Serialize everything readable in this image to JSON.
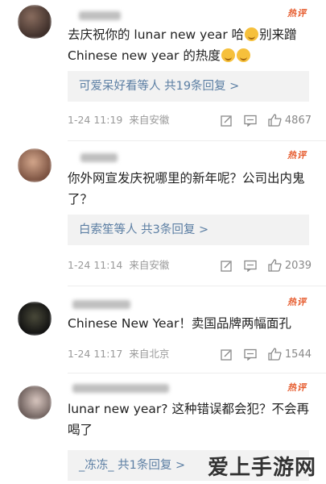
{
  "comments": [
    {
      "hot_label": "热评",
      "text_parts": [
        "去庆祝你的 lunar new year 哈",
        "别来蹭 Chinese new year 的热度"
      ],
      "replies": "可爱呆好看等人  共19条回复 >",
      "time": "1-24 11:19",
      "source": "来自安徽",
      "likes": "4867"
    },
    {
      "hot_label": "热评",
      "text": "你外网宣发庆祝哪里的新年呢？公司出内鬼了？",
      "replies": "白索笙等人  共3条回复 >",
      "time": "1-24 11:14",
      "source": "来自安徽",
      "likes": "2039"
    },
    {
      "hot_label": "热评",
      "text": "Chinese New Year！卖国品牌两幅面孔",
      "time": "1-24 11:17",
      "source": "来自北京",
      "likes": "1544"
    },
    {
      "hot_label": "热评",
      "text": "lunar new year? 这种错误都会犯？不会再喝了",
      "replies": "_冻冻_  共1条回复 >"
    }
  ],
  "watermark": "爱上手游网"
}
